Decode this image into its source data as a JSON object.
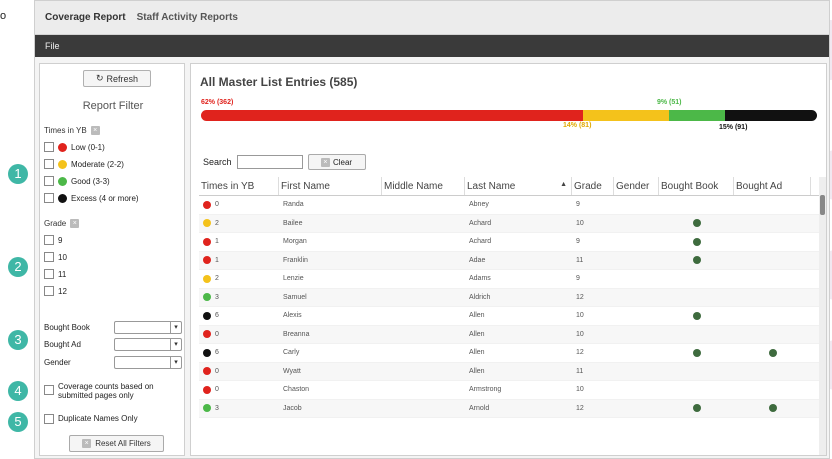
{
  "stub_text": "o",
  "tabs": [
    "Coverage Report",
    "Staff Activity Reports"
  ],
  "menu": [
    "File"
  ],
  "sidebar": {
    "refresh_label": "Refresh",
    "filter_title": "Report Filter",
    "times_label": "Times in YB",
    "times_options": [
      {
        "label": "Low (0-1)",
        "color": "#e0231d"
      },
      {
        "label": "Moderate (2-2)",
        "color": "#f4c21b"
      },
      {
        "label": "Good (3-3)",
        "color": "#4cb848"
      },
      {
        "label": "Excess (4 or more)",
        "color": "#111111"
      }
    ],
    "grade_label": "Grade",
    "grades": [
      "9",
      "10",
      "11",
      "12"
    ],
    "selects": [
      "Bought Book",
      "Bought Ad",
      "Gender"
    ],
    "coverage_label": "Coverage counts based on submitted pages only",
    "duplicate_label": "Duplicate Names Only",
    "reset_label": "Reset All Filters"
  },
  "callouts": [
    "1",
    "2",
    "3",
    "4",
    "5"
  ],
  "main": {
    "title": "All Master List Entries (585)",
    "bar": [
      {
        "label": "62% (362)",
        "pct": 62,
        "color": "#e0231d",
        "label_color": "#e0231d"
      },
      {
        "label": "14% (81)",
        "pct": 14,
        "color": "#f4c21b",
        "label_color": "#e0a800"
      },
      {
        "label": "9% (51)",
        "pct": 9,
        "color": "#4cb848",
        "label_color": "#4cb848"
      },
      {
        "label": "15% (91)",
        "pct": 15,
        "color": "#111111",
        "label_color": "#111111"
      }
    ],
    "search_label": "Search",
    "clear_label": "Clear",
    "columns": [
      "Times in YB",
      "First Name",
      "Middle Name",
      "Last Name",
      "Grade",
      "Gender",
      "Bought Book",
      "Bought Ad"
    ],
    "sort_arrow": "▲",
    "rows": [
      {
        "times": "0",
        "color": "#e0231d",
        "first": "Randa",
        "last": "Abney",
        "grade": "9",
        "book": false,
        "ad": false
      },
      {
        "times": "2",
        "color": "#f4c21b",
        "first": "Bailee",
        "last": "Achard",
        "grade": "10",
        "book": true,
        "ad": false
      },
      {
        "times": "1",
        "color": "#e0231d",
        "first": "Morgan",
        "last": "Achard",
        "grade": "9",
        "book": true,
        "ad": false
      },
      {
        "times": "1",
        "color": "#e0231d",
        "first": "Franklin",
        "last": "Adae",
        "grade": "11",
        "book": true,
        "ad": false
      },
      {
        "times": "2",
        "color": "#f4c21b",
        "first": "Lenzie",
        "last": "Adams",
        "grade": "9",
        "book": false,
        "ad": false
      },
      {
        "times": "3",
        "color": "#4cb848",
        "first": "Samuel",
        "last": "Aldrich",
        "grade": "12",
        "book": false,
        "ad": false
      },
      {
        "times": "6",
        "color": "#111111",
        "first": "Alexis",
        "last": "Allen",
        "grade": "10",
        "book": true,
        "ad": false
      },
      {
        "times": "0",
        "color": "#e0231d",
        "first": "Breanna",
        "last": "Allen",
        "grade": "10",
        "book": false,
        "ad": false
      },
      {
        "times": "6",
        "color": "#111111",
        "first": "Carly",
        "last": "Allen",
        "grade": "12",
        "book": true,
        "ad": true
      },
      {
        "times": "0",
        "color": "#e0231d",
        "first": "Wyatt",
        "last": "Allen",
        "grade": "11",
        "book": false,
        "ad": false
      },
      {
        "times": "0",
        "color": "#e0231d",
        "first": "Chaston",
        "last": "Armstrong",
        "grade": "10",
        "book": false,
        "ad": false
      },
      {
        "times": "3",
        "color": "#4cb848",
        "first": "Jacob",
        "last": "Arnold",
        "grade": "12",
        "book": true,
        "ad": true
      }
    ]
  }
}
